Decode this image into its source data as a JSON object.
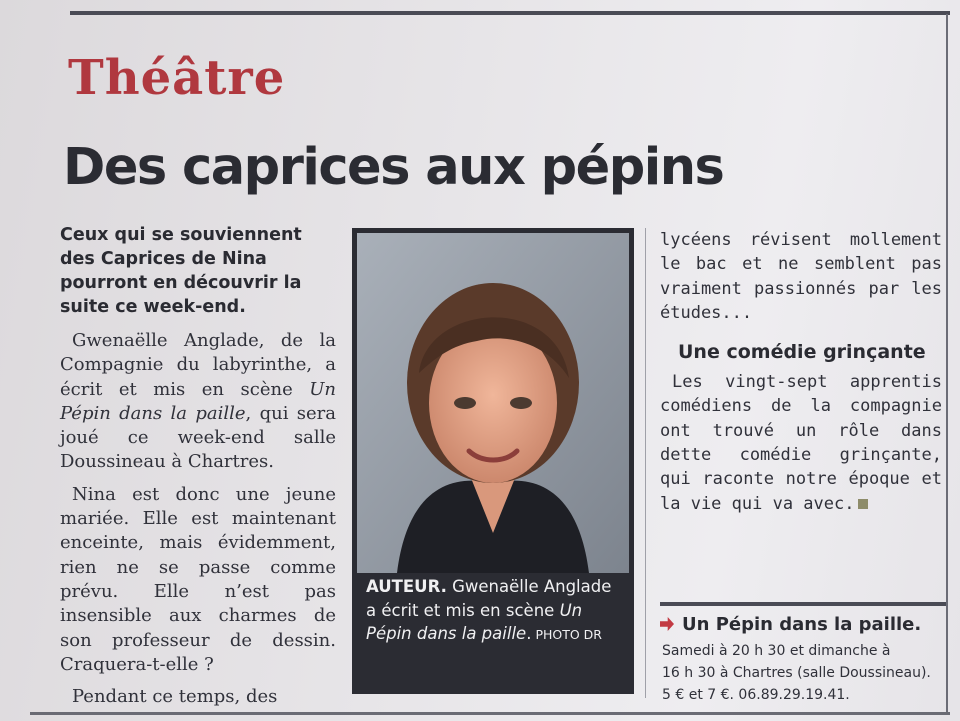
{
  "rubric": "Théâtre",
  "headline": "Des caprices aux pépins",
  "chapo": "Ceux qui se souviennent des Caprices de Nina pourront en découvrir la suite ce week-end.",
  "col1": {
    "p1": {
      "a": "Gwenaëlle Anglade, de la Compagnie du labyrinthe, a écrit et mis en scène ",
      "title": "Un Pépin dans la paille",
      "b": ", qui sera joué ce week-end salle Doussineau à Chartres."
    },
    "p2": "Nina est donc une jeune mariée. Elle est maintenant enceinte, mais évidemment, rien ne se passe comme prévu. Elle n’est pas insensible aux charmes de son professeur de dessin. Craquera-t-elle ?",
    "p3": "Pendant ce temps, des"
  },
  "col3": {
    "p1": "lycéens révisent mollement le bac et ne semblent pas vraiment passionnés par les études...",
    "subhead": "Une comédie grinçante",
    "p2": "Les vingt-sept apprentis comédiens de la compagnie ont trouvé un rôle dans dette comédie grinçante, qui raconte notre époque et la vie qui va avec."
  },
  "caption": {
    "lead": "AUTEUR.",
    "text_a": " Gwenaëlle Anglade a écrit et mis en scène ",
    "title": "Un Pépin dans la paille",
    "text_b": ".",
    "credit": "PHOTO DR"
  },
  "info": {
    "title": "Un Pépin dans la paille.",
    "line1": "Samedi à 20 h 30 et dimanche à",
    "line2": "16 h 30 à Chartres (salle Doussineau).",
    "line3": "5 € et 7 €. 06.89.29.19.41."
  },
  "colors": {
    "rubric": "#b0383f",
    "text": "#2b2c33",
    "arrow": "#c23a43",
    "photo_frame": "#2b2c33"
  }
}
